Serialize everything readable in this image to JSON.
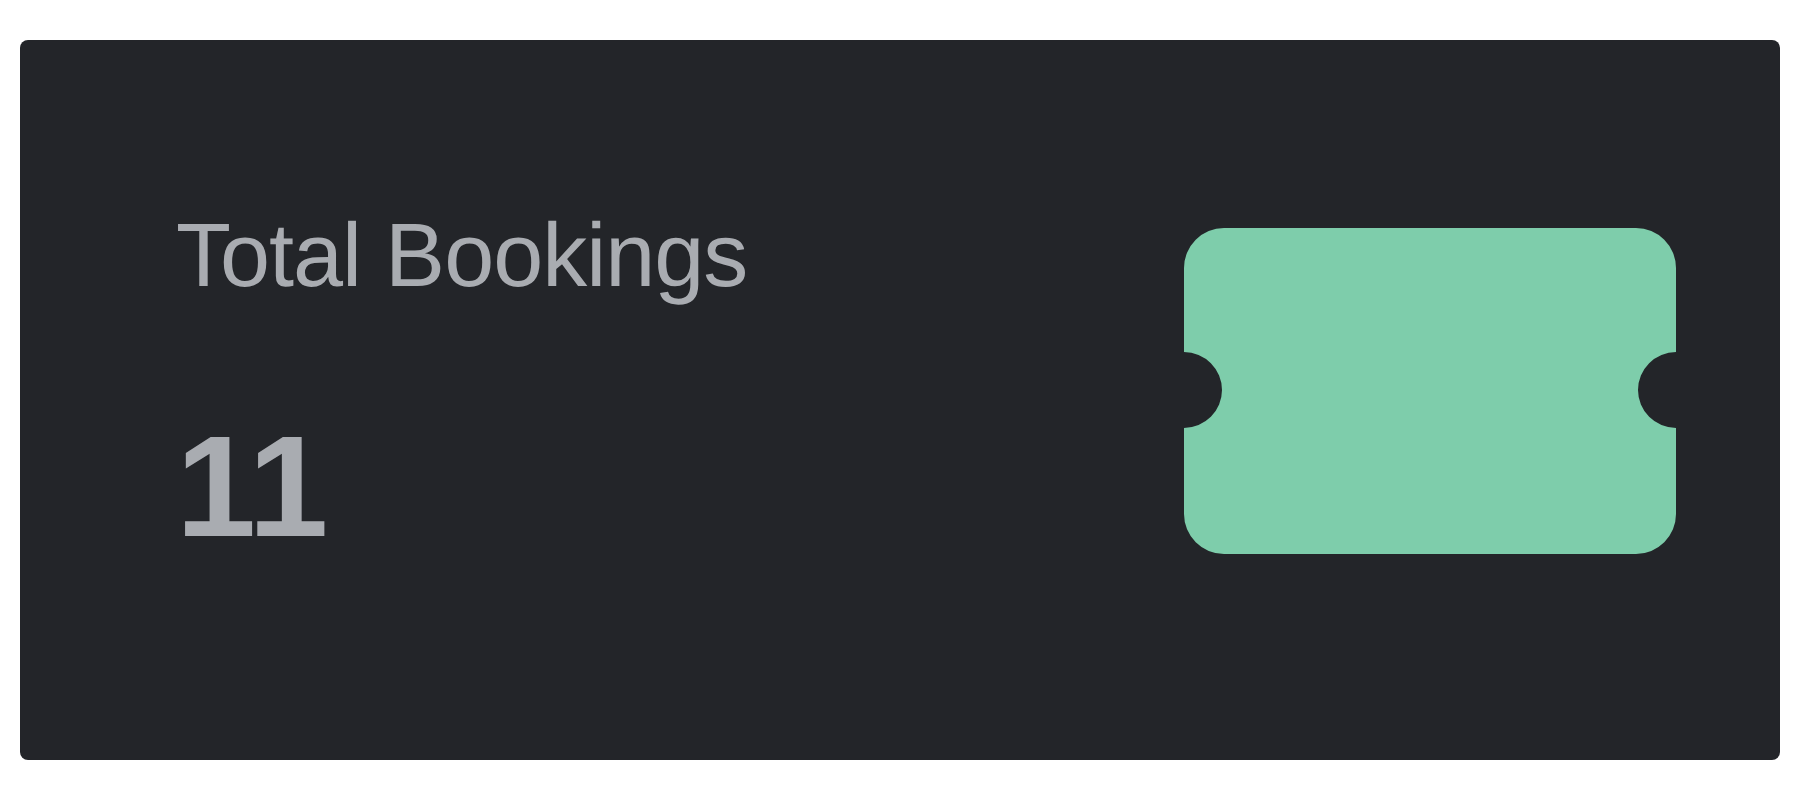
{
  "card": {
    "title": "Total Bookings",
    "value": "11"
  }
}
